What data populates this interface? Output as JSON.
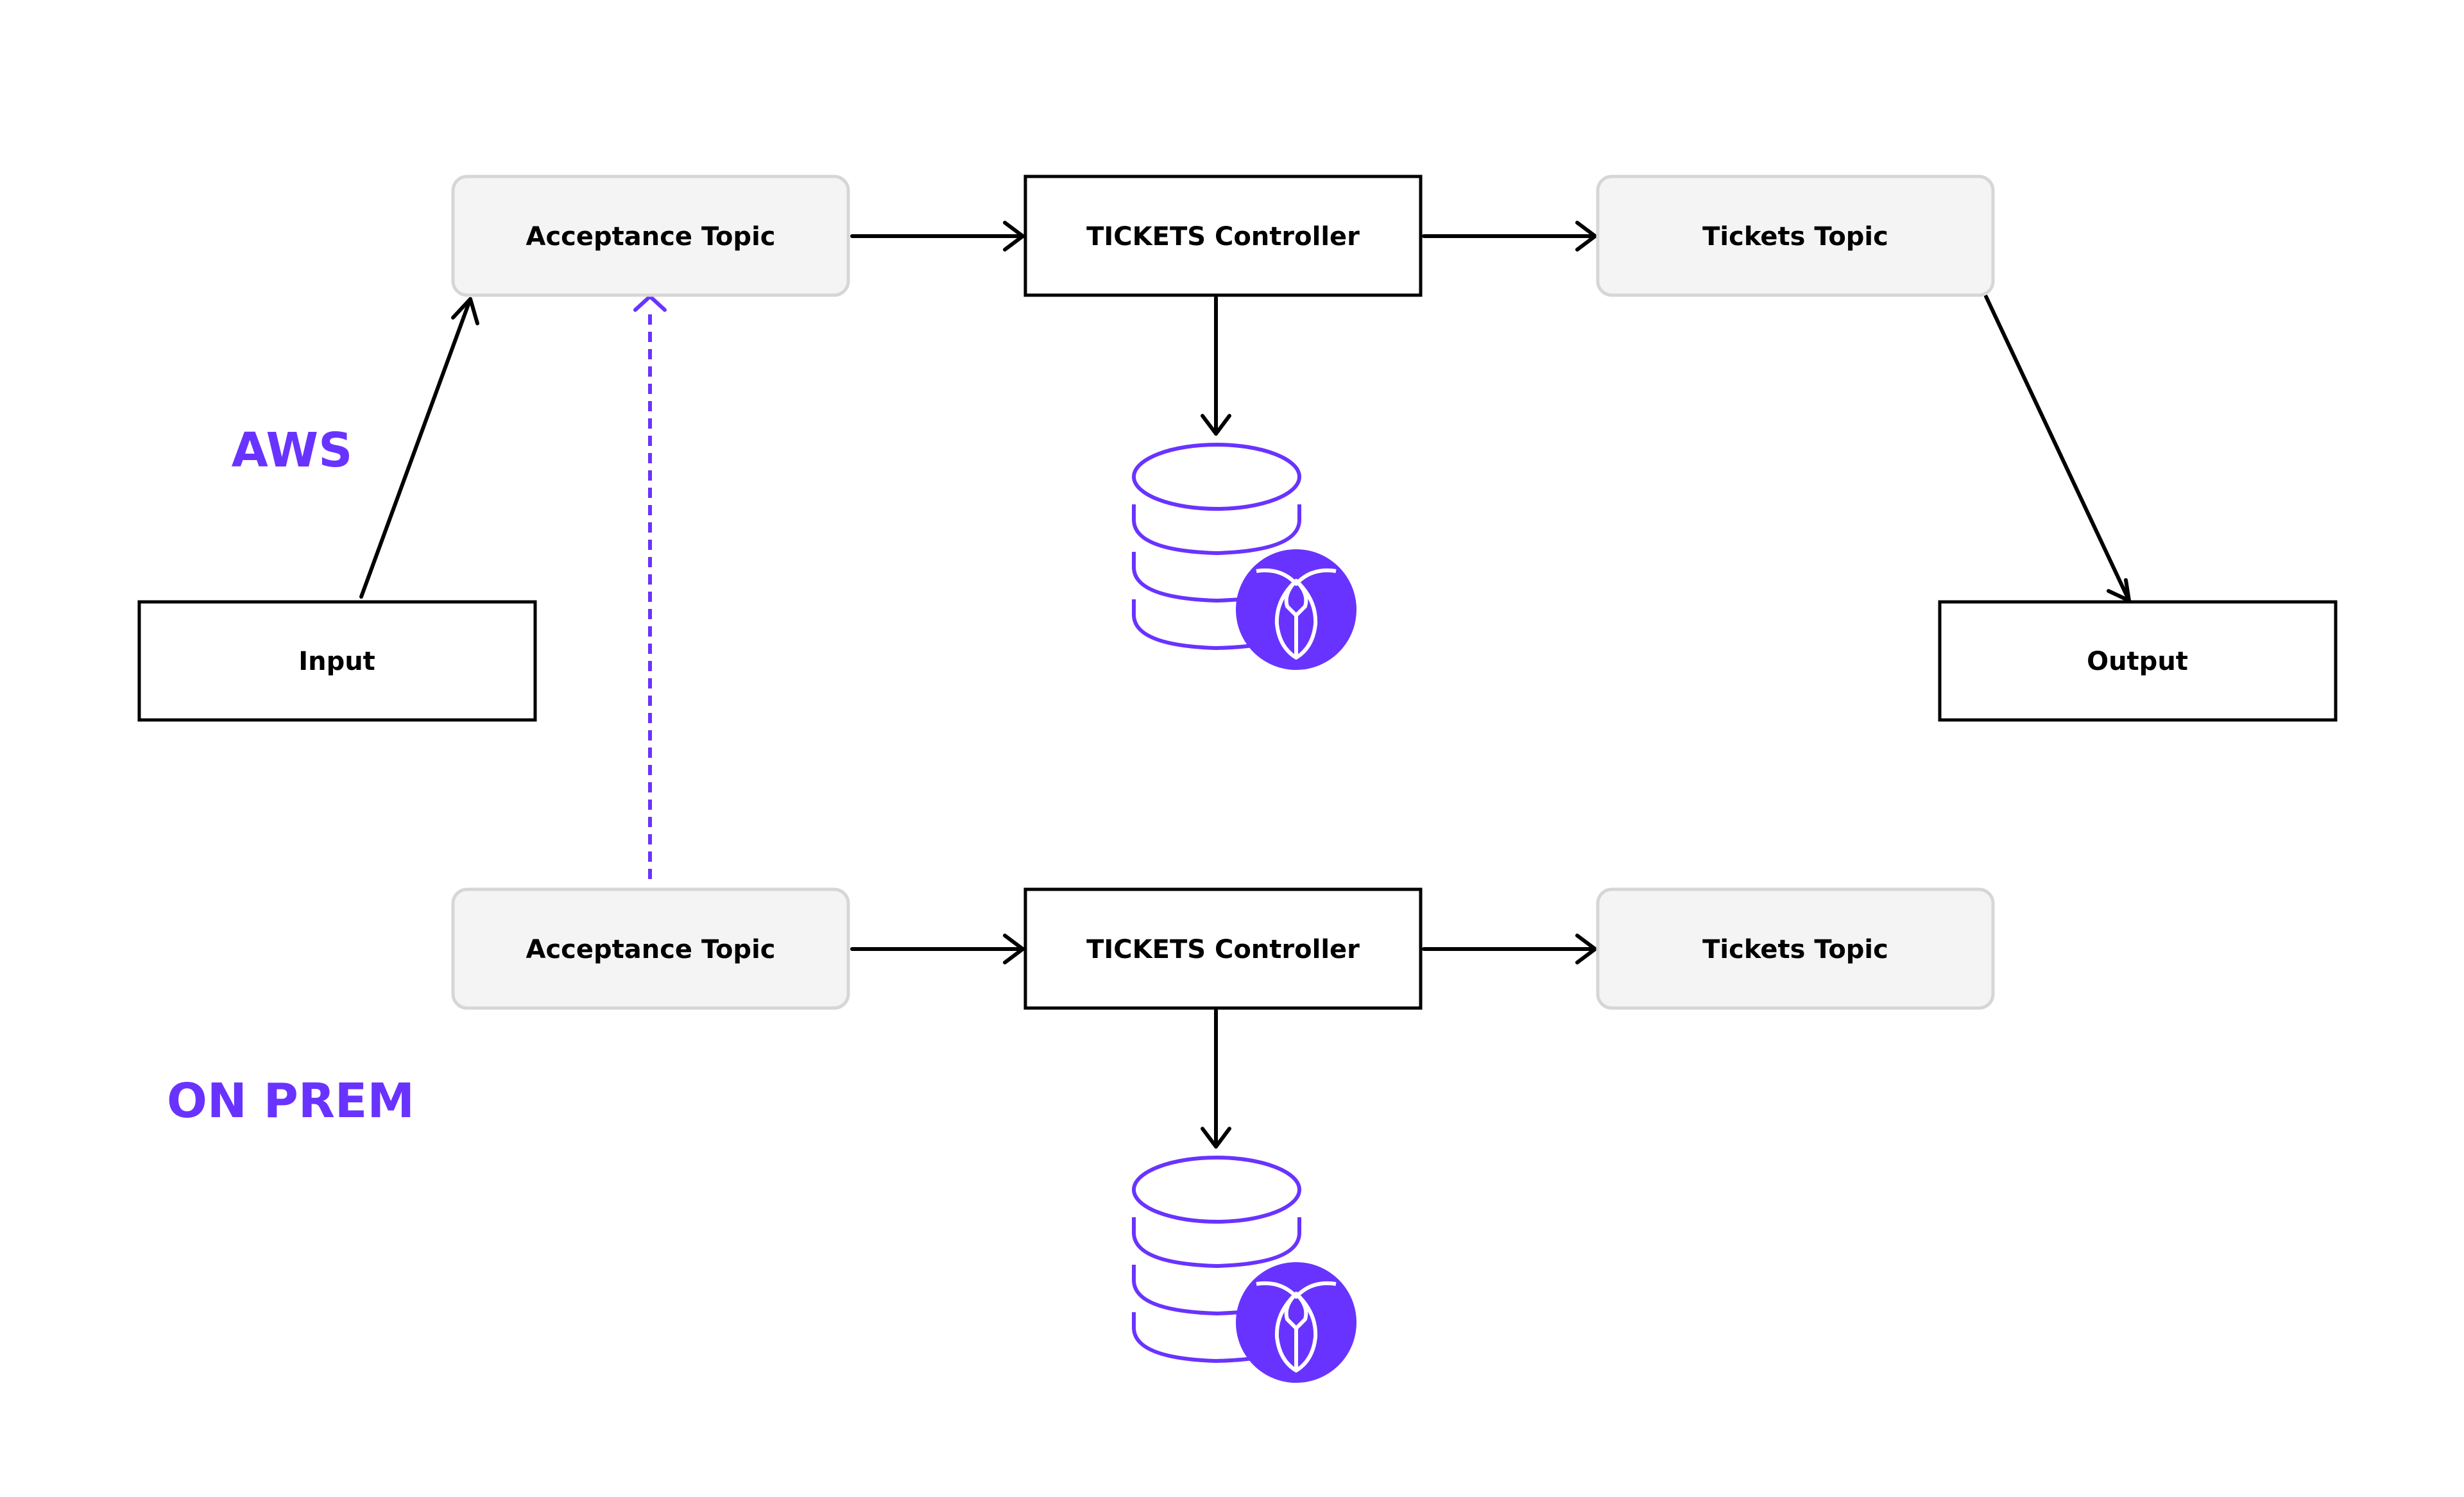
{
  "diagram": {
    "accent_color": "#6933FF",
    "topic_fill": "#F4F4F4",
    "topic_stroke": "#D6D6D6",
    "edge_color": "#000000",
    "regions": {
      "aws": "AWS",
      "on_prem": "ON PREM"
    },
    "nodes": {
      "aws_acceptance": "Acceptance Topic",
      "aws_controller": "TICKETS Controller",
      "aws_tickets": "Tickets Topic",
      "input": "Input",
      "output": "Output",
      "onprem_acceptance": "Acceptance Topic",
      "onprem_controller": "TICKETS Controller",
      "onprem_tickets": "Tickets Topic"
    },
    "icons": {
      "aws_db": "cockroachdb-database-icon",
      "onprem_db": "cockroachdb-database-icon"
    },
    "edges": [
      {
        "from": "input",
        "to": "aws_acceptance",
        "style": "solid"
      },
      {
        "from": "aws_acceptance",
        "to": "aws_controller",
        "style": "solid"
      },
      {
        "from": "aws_controller",
        "to": "aws_tickets",
        "style": "solid"
      },
      {
        "from": "aws_controller",
        "to": "aws_db",
        "style": "solid"
      },
      {
        "from": "aws_tickets",
        "to": "output",
        "style": "solid"
      },
      {
        "from": "onprem_acceptance",
        "to": "aws_acceptance",
        "style": "dashed"
      },
      {
        "from": "onprem_acceptance",
        "to": "onprem_controller",
        "style": "solid"
      },
      {
        "from": "onprem_controller",
        "to": "onprem_tickets",
        "style": "solid"
      },
      {
        "from": "onprem_controller",
        "to": "onprem_db",
        "style": "solid"
      }
    ]
  }
}
